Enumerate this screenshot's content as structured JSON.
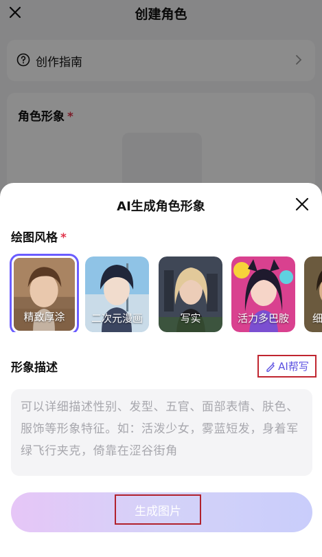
{
  "background": {
    "title": "创建角色",
    "guide_label": "创作指南",
    "card_title": "角色形象",
    "required_mark": "*"
  },
  "sheet": {
    "title": "AI生成角色形象",
    "style_section_label": "绘图风格",
    "required_mark": "*",
    "styles": [
      {
        "label": "精致厚涂",
        "selected": true
      },
      {
        "label": "二次元漫画",
        "selected": false
      },
      {
        "label": "写实",
        "selected": false
      },
      {
        "label": "活力多巴胺",
        "selected": false
      },
      {
        "label": "细",
        "selected": false
      }
    ],
    "desc_section_label": "形象描述",
    "ai_write_label": "AI帮写",
    "desc_placeholder": "可以详细描述性别、发型、五官、面部表情、肤色、服饰等形象特征。如：活泼少女，雾蓝短发，身着军绿飞行夹克，倚靠在涩谷街角",
    "generate_label": "生成图片"
  },
  "colors": {
    "accent": "#6a5cff",
    "required": "#e0334a",
    "highlight_box": "#c0252f"
  }
}
